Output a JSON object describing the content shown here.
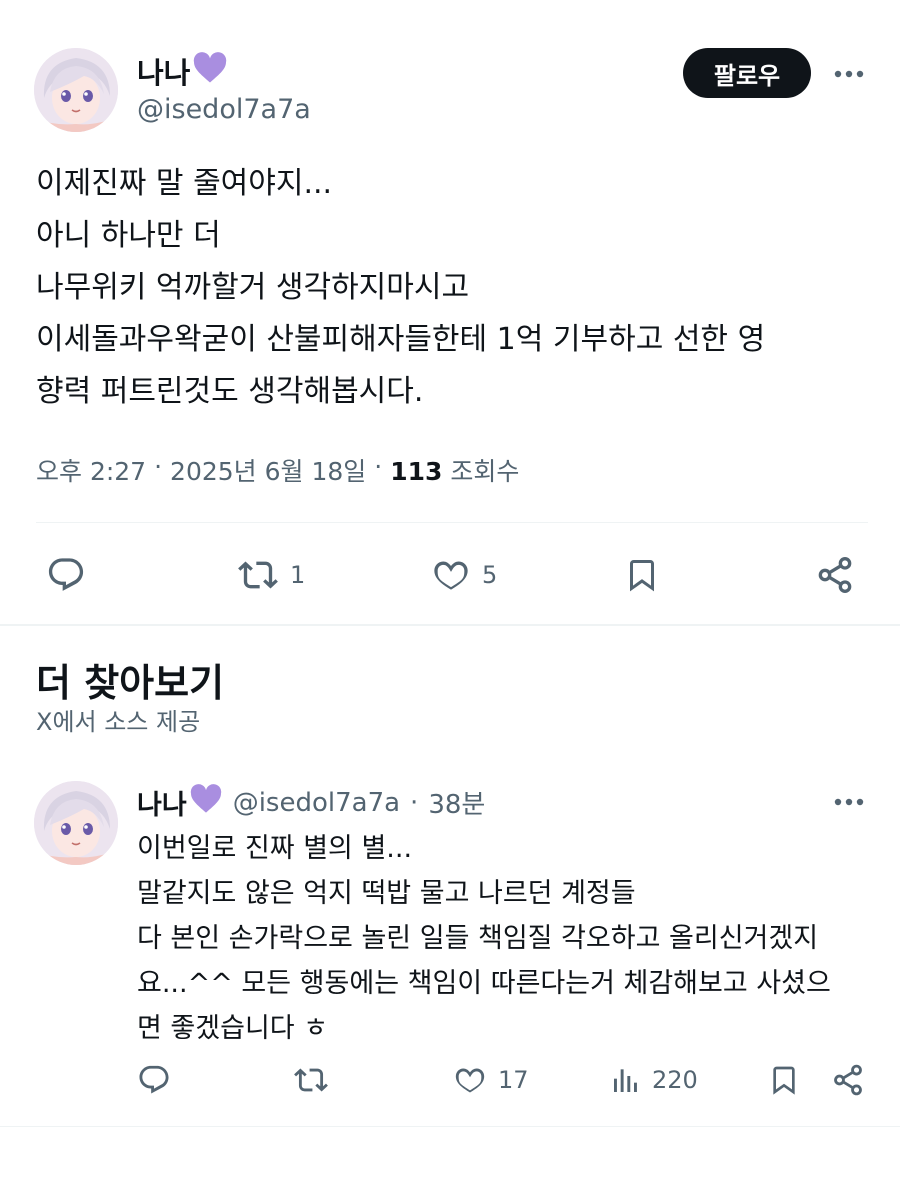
{
  "main_tweet": {
    "author_name": "나나",
    "author_handle": "@isedol7a7a",
    "follow_label": "팔로우",
    "text_lines": [
      "이제진짜 말 줄여야지...",
      "아니 하나만 더",
      "나무위키 억까할거 생각하지마시고",
      "이세돌과우왁굳이 산불피해자들한테 1억 기부하고 선한 영",
      "향력 퍼트린것도 생각해봅시다."
    ],
    "time": "오후 2:27",
    "date": "2025년 6월 18일",
    "views_count": "113",
    "views_label": "조회수",
    "retweets": "1",
    "likes": "5"
  },
  "more_section": {
    "title": "더 찾아보기",
    "subtitle": "X에서 소스 제공"
  },
  "reply_tweet": {
    "author_name": "나나",
    "author_handle": "@isedol7a7a",
    "age": "38분",
    "text_lines": [
      "이번일로 진짜 별의 별...",
      "말같지도 않은 억지 떡밥 물고 나르던 계정들",
      "다 본인 손가락으로 놀린 일들 책임질 각오하고 올리신거겠지",
      "요...^^ 모든 행동에는 책임이 따른다는거 체감해보고 사셨으",
      "면 좋겠습니다 ㅎ"
    ],
    "likes": "17",
    "views": "220"
  },
  "colors": {
    "text_primary": "#0f1419",
    "text_secondary": "#536471",
    "heart_purple": "#a98ee0",
    "divider": "#eff3f4"
  },
  "icons": [
    "more-icon",
    "reply-icon",
    "retweet-icon",
    "like-icon",
    "bookmark-icon",
    "share-icon",
    "views-icon",
    "purple-heart-icon"
  ]
}
